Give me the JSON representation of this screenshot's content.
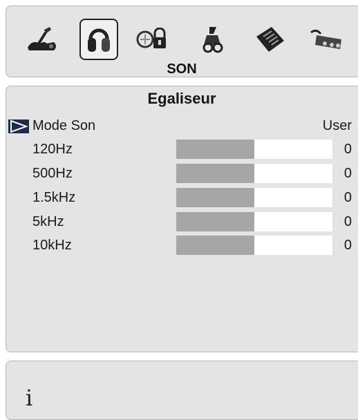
{
  "menu": {
    "title": "SON",
    "icons": [
      {
        "name": "picture-icon",
        "selected": false
      },
      {
        "name": "headphones-icon",
        "selected": true
      },
      {
        "name": "lock-icon",
        "selected": false
      },
      {
        "name": "setup-icon",
        "selected": false
      },
      {
        "name": "teletext-icon",
        "selected": false
      },
      {
        "name": "connector-icon",
        "selected": false
      }
    ]
  },
  "equalizer": {
    "title": "Egaliseur",
    "mode": {
      "label": "Mode Son",
      "value": "User"
    },
    "bands": [
      {
        "label": "120Hz",
        "value": "0",
        "level": 0.5
      },
      {
        "label": "500Hz",
        "value": "0",
        "level": 0.5
      },
      {
        "label": "1.5kHz",
        "value": "0",
        "level": 0.5
      },
      {
        "label": "5kHz",
        "value": "0",
        "level": 0.5
      },
      {
        "label": "10kHz",
        "value": "0",
        "level": 0.5
      }
    ]
  },
  "info": {
    "icon": "info-icon",
    "glyph": "i"
  }
}
